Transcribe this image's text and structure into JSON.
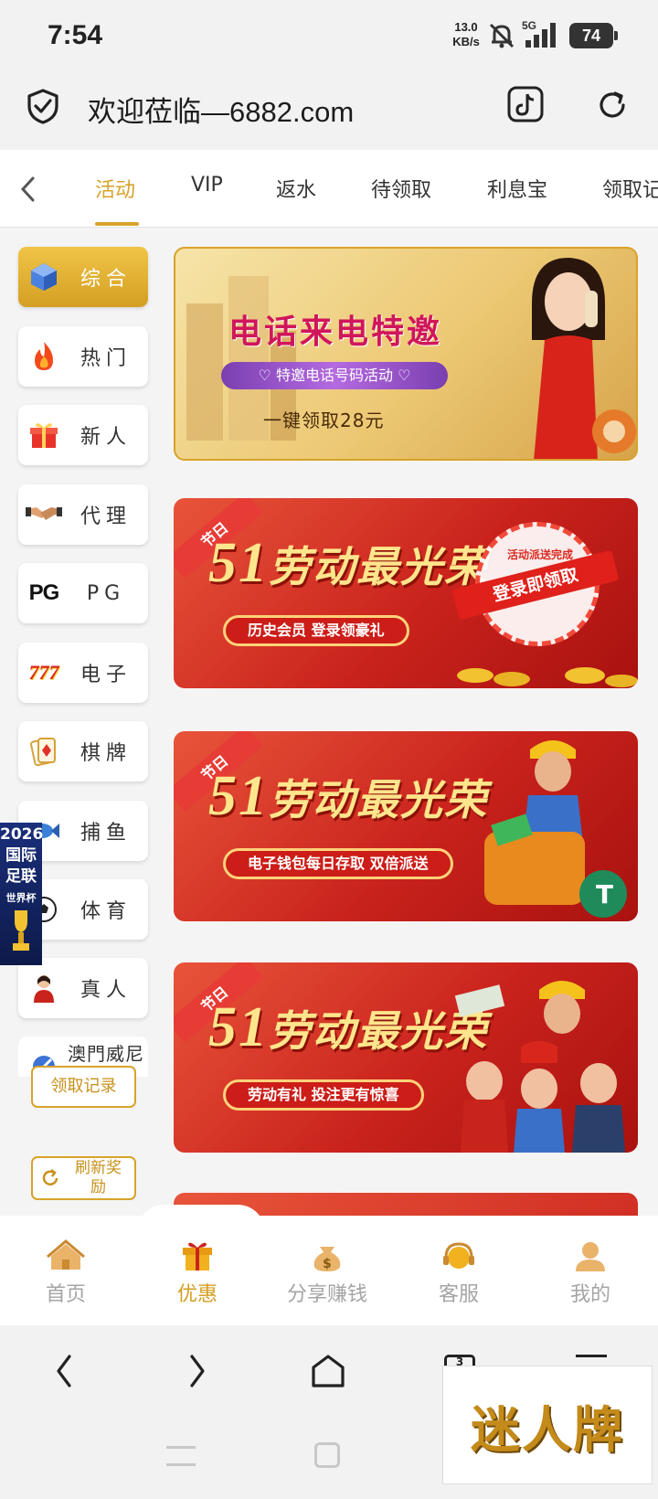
{
  "status_bar": {
    "time": "7:54",
    "net_speed_value": "13.0",
    "net_speed_unit": "KB/s",
    "signal": "5G",
    "battery": "74"
  },
  "browser": {
    "url": "欢迎莅临—6882.com"
  },
  "tabs": [
    {
      "label": "活动",
      "active": true
    },
    {
      "label": "VIP"
    },
    {
      "label": "返水"
    },
    {
      "label": "待领取"
    },
    {
      "label": "利息宝"
    },
    {
      "label": "领取记"
    }
  ],
  "categories": [
    {
      "label": "综合",
      "icon": "cube-icon",
      "active": true
    },
    {
      "label": "热门",
      "icon": "flame-icon"
    },
    {
      "label": "新人",
      "icon": "gift-icon"
    },
    {
      "label": "代理",
      "icon": "handshake-icon"
    },
    {
      "label": "PG",
      "icon": "pg-logo-icon"
    },
    {
      "label": "电子",
      "icon": "slot-777-icon"
    },
    {
      "label": "棋牌",
      "icon": "cards-icon"
    },
    {
      "label": "捕鱼",
      "icon": "fish-icon"
    },
    {
      "label": "体育",
      "icon": "soccer-ball-icon"
    },
    {
      "label": "真人",
      "icon": "dealer-icon"
    },
    {
      "label": "澳門威尼斯人",
      "icon": "venetian-icon"
    }
  ],
  "sidebar_buttons": {
    "records": "领取记录",
    "refresh_line1": "刷新奖",
    "refresh_line2": "励"
  },
  "floating_ad": {
    "line1": "2026",
    "line2": "国际",
    "line3": "足联",
    "line4": "世界杯"
  },
  "banners": [
    {
      "title": "电话来电特邀",
      "subtitle": "特邀电话号码活动",
      "footer": "一键领取28元"
    },
    {
      "badge": "节日",
      "headline_number": "51",
      "headline": "劳动最光荣",
      "pill": "历史会员 登录领豪礼",
      "stamp_ring": "活动派送完成",
      "stamp": "登录即领取"
    },
    {
      "badge": "节日",
      "headline_number": "51",
      "headline": "劳动最光荣",
      "pill": "电子钱包每日存取 双倍派送"
    },
    {
      "badge": "节日",
      "headline_number": "51",
      "headline": "劳动最光荣",
      "pill": "劳动有礼 投注更有惊喜"
    }
  ],
  "bottom_nav": [
    {
      "label": "首页",
      "icon": "home-icon"
    },
    {
      "label": "优惠",
      "icon": "gift-box-icon",
      "active": true
    },
    {
      "label": "分享赚钱",
      "icon": "money-bag-icon"
    },
    {
      "label": "客服",
      "icon": "headset-icon"
    },
    {
      "label": "我的",
      "icon": "user-icon"
    }
  ],
  "watermark": "迷人牌",
  "system_nav": {
    "tabs_count": "3"
  }
}
